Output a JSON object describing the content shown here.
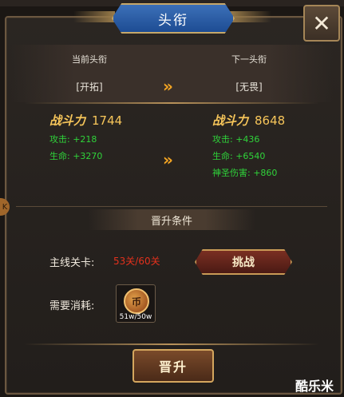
{
  "dialog": {
    "title": "头衔",
    "close_icon": "✕"
  },
  "current": {
    "header": "当前头衔",
    "tag": "[开拓]",
    "power_label": "战斗力",
    "power_value": "1744",
    "stats": [
      "攻击: +218",
      "生命: +3270"
    ]
  },
  "next": {
    "header": "下一头衔",
    "tag": "[无畏]",
    "power_label": "战斗力",
    "power_value": "8648",
    "stats": [
      "攻击: +436",
      "生命: +6540",
      "神圣伤害: +860"
    ]
  },
  "arrows": "»",
  "conditions": {
    "header": "晋升条件",
    "stage_label": "主线关卡:",
    "stage_progress": "53关/60关",
    "challenge_label": "挑战",
    "cost_label": "需要消耗:",
    "item_icon": "coin-icon",
    "item_glyph": "币",
    "item_count": "51w/50w"
  },
  "promote_label": "晋升",
  "side_tab_glyph": "K",
  "watermark": "酷乐米",
  "colors": {
    "gold": "#f7c65a",
    "green_stat": "#2fd33a",
    "red_progress": "#e3311d",
    "arrow_orange": "#f5a623",
    "title_blue": "#2e62aa"
  }
}
